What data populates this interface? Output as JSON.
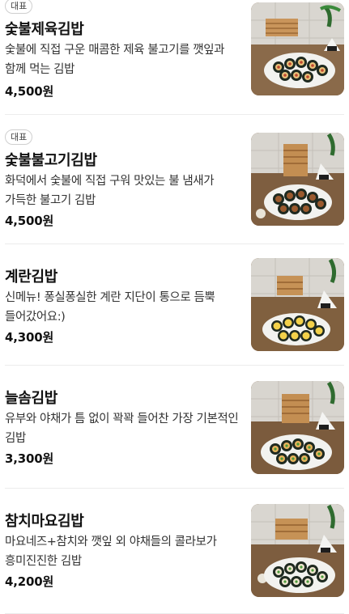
{
  "menu": {
    "items": [
      {
        "badge": "대표",
        "name": "숯불제육김밥",
        "description": "숯불에 직접 구운 매콤한 제육 불고기를 깻잎과 함께 먹는 김밥",
        "price": "4,500원",
        "image_icon": "kimbap-photo-icon"
      },
      {
        "badge": "대표",
        "name": "숯불불고기김밥",
        "description": "화덕에서 숯불에 직접 구워 맛있는 불 냄새가 가득한 불고기 김밥",
        "price": "4,500원",
        "image_icon": "kimbap-photo-icon"
      },
      {
        "badge": "",
        "name": "계란김밥",
        "description": "신메뉴! 퐁실퐁실한 계란 지단이 통으로 듬뿍 들어갔어요:)",
        "price": "4,300원",
        "image_icon": "kimbap-photo-icon"
      },
      {
        "badge": "",
        "name": "늘솜김밥",
        "description": "유부와 야채가 틈 없이 꽉꽉 들어찬 가장 기본적인 김밥",
        "price": "3,300원",
        "image_icon": "kimbap-photo-icon"
      },
      {
        "badge": "",
        "name": "참치마요김밥",
        "description": "마요네즈+참치와 깻잎 외 야채들의 콜라보가 흥미진진한 김밥",
        "price": "4,200원",
        "image_icon": "kimbap-photo-icon"
      }
    ]
  }
}
